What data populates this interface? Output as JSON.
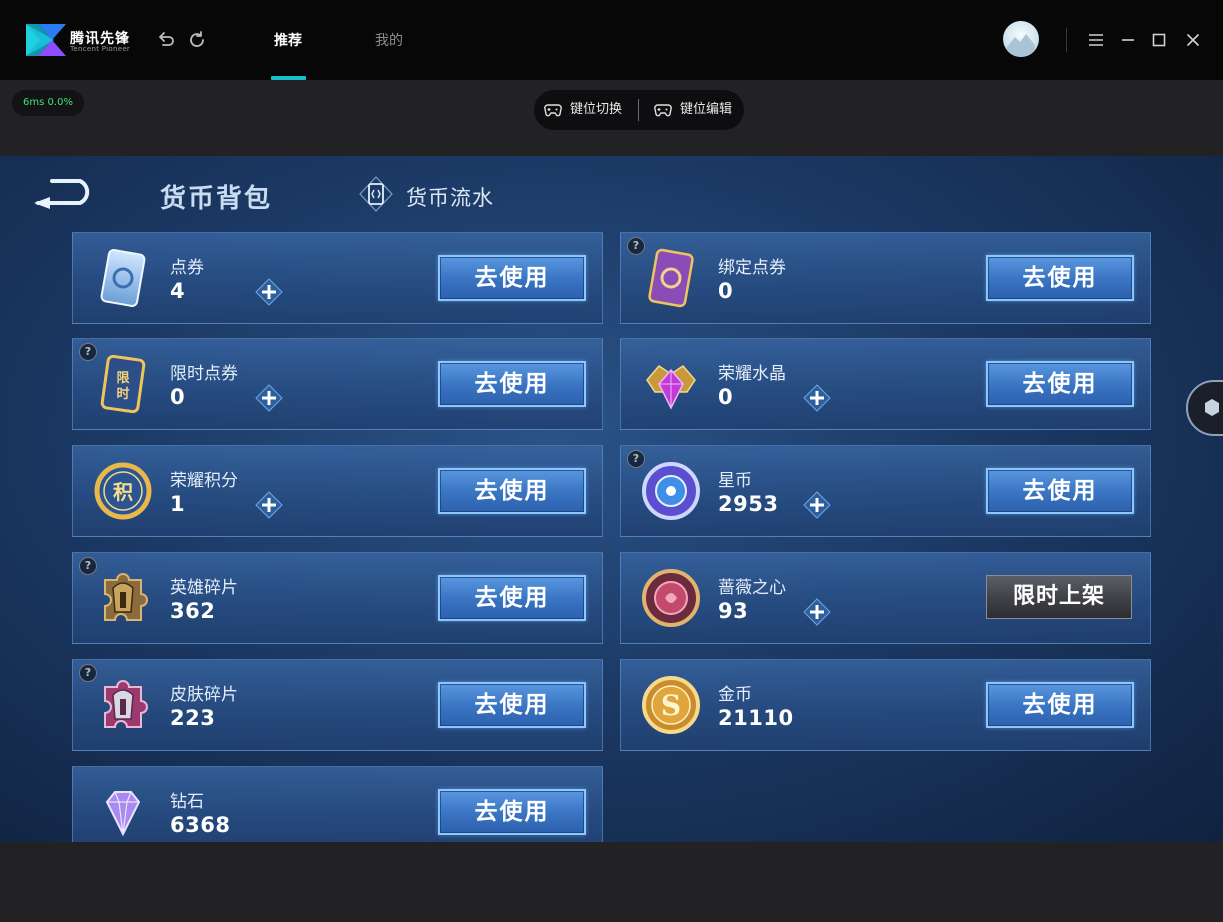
{
  "titlebar": {
    "brand": "腾讯先锋",
    "brand_sub": "Tencent Pioneer",
    "tabs": [
      {
        "label": "推荐",
        "active": true
      },
      {
        "label": "我的",
        "active": false
      }
    ],
    "accent_color": "#19c0c9"
  },
  "toolbar": {
    "ping": "6ms  0.0%",
    "key_switch": "键位切换",
    "key_edit": "键位编辑"
  },
  "game": {
    "title": "货币背包",
    "ledger": "货币流水",
    "use_label": "去使用",
    "limited_label": "限时上架",
    "items": [
      {
        "name": "点券",
        "value": "4",
        "icon": "coupon-card-icon"
      },
      {
        "name": "绑定点券",
        "value": "0",
        "icon": "bound-coupon-icon"
      },
      {
        "name": "限时点券",
        "value": "0",
        "icon": "limited-coupon-icon"
      },
      {
        "name": "荣耀水晶",
        "value": "0",
        "icon": "glory-crystal-icon"
      },
      {
        "name": "荣耀积分",
        "value": "1",
        "icon": "glory-points-icon"
      },
      {
        "name": "星币",
        "value": "2953",
        "icon": "star-coin-icon"
      },
      {
        "name": "英雄碎片",
        "value": "362",
        "icon": "hero-fragment-icon"
      },
      {
        "name": "蔷薇之心",
        "value": "93",
        "icon": "rose-heart-icon"
      },
      {
        "name": "皮肤碎片",
        "value": "223",
        "icon": "skin-fragment-icon"
      },
      {
        "name": "金币",
        "value": "21110",
        "icon": "gold-coin-icon"
      },
      {
        "name": "钻石",
        "value": "6368",
        "icon": "diamond-icon"
      }
    ]
  }
}
